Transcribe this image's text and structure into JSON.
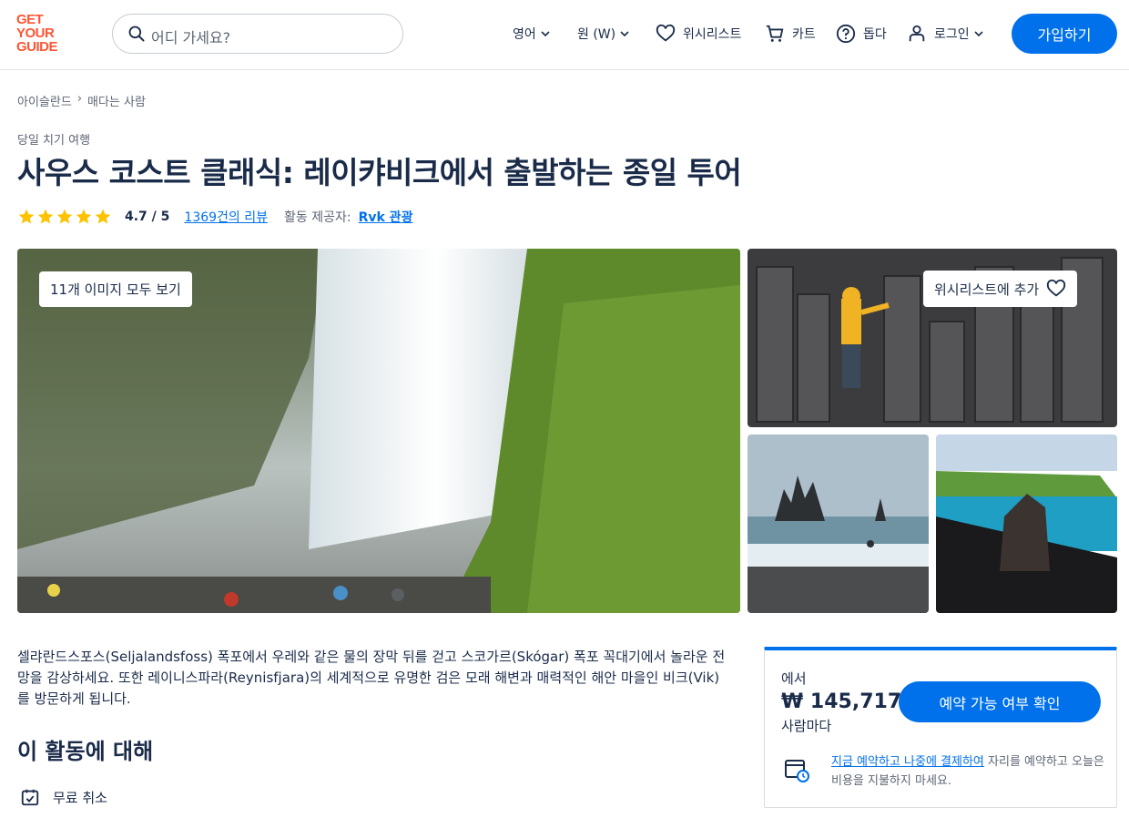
{
  "header": {
    "logo_lines": [
      "GET",
      "YOUR",
      "GUIDE"
    ],
    "search_placeholder": "어디 가세요?",
    "language_label": "영어",
    "currency_label": "원 (W)",
    "wishlist_label": "위시리스트",
    "cart_label": "카트",
    "help_label": "돕다",
    "login_label": "로그인",
    "signup_label": "가입하기"
  },
  "breadcrumb": {
    "items": [
      "아이슬란드",
      "매다는 사람"
    ],
    "separator": "›"
  },
  "activity": {
    "category": "당일 치기 여행",
    "title": "사우스 코스트 클래식: 레이캬비크에서 출발하는 종일 투어",
    "rating_stars": 5,
    "rating_score": "4.7 / 5",
    "reviews_label": "1369건의 리뷰",
    "provider_label": "활동 제공자:",
    "provider_name": "Rvk 관광"
  },
  "gallery": {
    "view_all_label": "11개 이미지 모두 보기",
    "wishlist_add_label": "위시리스트에 추가"
  },
  "description": "셀랴란드스포스(Seljalandsfoss) 폭포에서 우레와 같은 물의 장막 뒤를 걷고 스코가르(Skógar) 폭포 꼭대기에서 놀라운 전망을 감상하세요. 또한 레이니스파라(Reynisfjara)의 세계적으로 유명한 검은 모래 해변과 매력적인 해안 마을인 비크(Vik)를 방문하게 됩니다.",
  "about": {
    "title": "이 활동에 대해",
    "free_cancel_label": "무료 취소"
  },
  "booking": {
    "from_label": "에서",
    "price": "₩ 145,717",
    "per_person_label": "사람마다",
    "check_button_label": "예약 가능 여부 확인",
    "reserve_link": "지금 예약하고 나중에 결제하여",
    "reserve_text": " 자리를 예약하고 오늘은 비용을 지불하지 마세요."
  },
  "colors": {
    "brand": "#ff5533",
    "accent_blue": "#0071eb",
    "star": "#fdc200",
    "text_dark": "#1a2b49"
  }
}
